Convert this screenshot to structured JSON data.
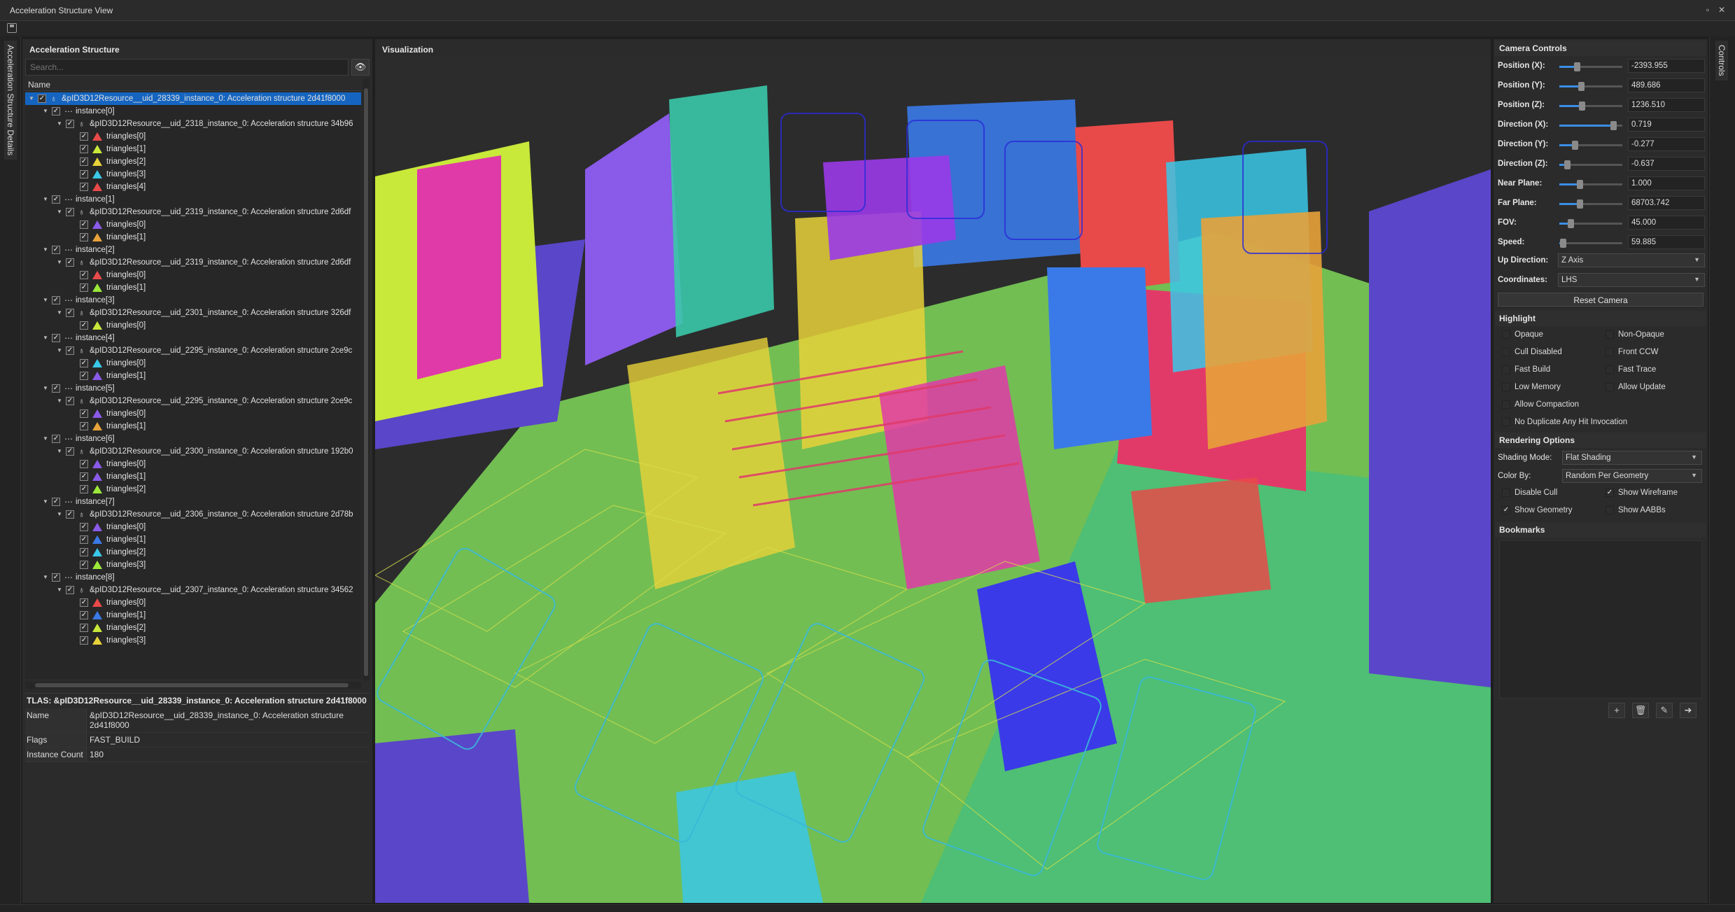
{
  "window": {
    "title": "Acceleration Structure View"
  },
  "left_tab": "Acceleration Structure Details",
  "right_tab": "Controls",
  "as_panel": {
    "title": "Acceleration Structure",
    "search_placeholder": "Search...",
    "column": "Name",
    "tree": [
      {
        "level": 0,
        "kind": "tlas",
        "label": "&pID3D12Resource__uid_28339_instance_0: Acceleration structure 2d41f8000",
        "selected": true
      },
      {
        "level": 1,
        "kind": "instance",
        "label": "instance[0]"
      },
      {
        "level": 2,
        "kind": "blas",
        "label": "&pID3D12Resource__uid_2318_instance_0: Acceleration structure 34b96"
      },
      {
        "level": 3,
        "kind": "tri",
        "color": "#e84a4a",
        "label": "triangles[0]"
      },
      {
        "level": 3,
        "kind": "tri",
        "color": "#c8e83a",
        "label": "triangles[1]"
      },
      {
        "level": 3,
        "kind": "tri",
        "color": "#e8d23a",
        "label": "triangles[2]"
      },
      {
        "level": 3,
        "kind": "tri",
        "color": "#3ac8e8",
        "label": "triangles[3]"
      },
      {
        "level": 3,
        "kind": "tri",
        "color": "#e84a4a",
        "label": "triangles[4]"
      },
      {
        "level": 1,
        "kind": "instance",
        "label": "instance[1]"
      },
      {
        "level": 2,
        "kind": "blas",
        "label": "&pID3D12Resource__uid_2319_instance_0: Acceleration structure 2d6df"
      },
      {
        "level": 3,
        "kind": "tri",
        "color": "#8a5ae8",
        "label": "triangles[0]"
      },
      {
        "level": 3,
        "kind": "tri",
        "color": "#e8a23a",
        "label": "triangles[1]"
      },
      {
        "level": 1,
        "kind": "instance",
        "label": "instance[2]"
      },
      {
        "level": 2,
        "kind": "blas",
        "label": "&pID3D12Resource__uid_2319_instance_0: Acceleration structure 2d6df"
      },
      {
        "level": 3,
        "kind": "tri",
        "color": "#e84a4a",
        "label": "triangles[0]"
      },
      {
        "level": 3,
        "kind": "tri",
        "color": "#9ae83a",
        "label": "triangles[1]"
      },
      {
        "level": 1,
        "kind": "instance",
        "label": "instance[3]"
      },
      {
        "level": 2,
        "kind": "blas",
        "label": "&pID3D12Resource__uid_2301_instance_0: Acceleration structure 326df"
      },
      {
        "level": 3,
        "kind": "tri",
        "color": "#c8e83a",
        "label": "triangles[0]"
      },
      {
        "level": 1,
        "kind": "instance",
        "label": "instance[4]"
      },
      {
        "level": 2,
        "kind": "blas",
        "label": "&pID3D12Resource__uid_2295_instance_0: Acceleration structure 2ce9c"
      },
      {
        "level": 3,
        "kind": "tri",
        "color": "#3ac8e8",
        "label": "triangles[0]"
      },
      {
        "level": 3,
        "kind": "tri",
        "color": "#8a5ae8",
        "label": "triangles[1]"
      },
      {
        "level": 1,
        "kind": "instance",
        "label": "instance[5]"
      },
      {
        "level": 2,
        "kind": "blas",
        "label": "&pID3D12Resource__uid_2295_instance_0: Acceleration structure 2ce9c"
      },
      {
        "level": 3,
        "kind": "tri",
        "color": "#8a5ae8",
        "label": "triangles[0]"
      },
      {
        "level": 3,
        "kind": "tri",
        "color": "#e8a23a",
        "label": "triangles[1]"
      },
      {
        "level": 1,
        "kind": "instance",
        "label": "instance[6]"
      },
      {
        "level": 2,
        "kind": "blas",
        "label": "&pID3D12Resource__uid_2300_instance_0: Acceleration structure 192b0"
      },
      {
        "level": 3,
        "kind": "tri",
        "color": "#8a5ae8",
        "label": "triangles[0]"
      },
      {
        "level": 3,
        "kind": "tri",
        "color": "#8a5ae8",
        "label": "triangles[1]"
      },
      {
        "level": 3,
        "kind": "tri",
        "color": "#9ae83a",
        "label": "triangles[2]"
      },
      {
        "level": 1,
        "kind": "instance",
        "label": "instance[7]"
      },
      {
        "level": 2,
        "kind": "blas",
        "label": "&pID3D12Resource__uid_2306_instance_0: Acceleration structure 2d78b"
      },
      {
        "level": 3,
        "kind": "tri",
        "color": "#8a5ae8",
        "label": "triangles[0]"
      },
      {
        "level": 3,
        "kind": "tri",
        "color": "#3a7ae8",
        "label": "triangles[1]"
      },
      {
        "level": 3,
        "kind": "tri",
        "color": "#3ac8e8",
        "label": "triangles[2]"
      },
      {
        "level": 3,
        "kind": "tri",
        "color": "#9ae83a",
        "label": "triangles[3]"
      },
      {
        "level": 1,
        "kind": "instance",
        "label": "instance[8]"
      },
      {
        "level": 2,
        "kind": "blas",
        "label": "&pID3D12Resource__uid_2307_instance_0: Acceleration structure 34562"
      },
      {
        "level": 3,
        "kind": "tri",
        "color": "#e84a4a",
        "label": "triangles[0]"
      },
      {
        "level": 3,
        "kind": "tri",
        "color": "#3a7ae8",
        "label": "triangles[1]"
      },
      {
        "level": 3,
        "kind": "tri",
        "color": "#c8e83a",
        "label": "triangles[2]"
      },
      {
        "level": 3,
        "kind": "tri",
        "color": "#e8d23a",
        "label": "triangles[3]"
      }
    ],
    "details_title": "TLAS: &pID3D12Resource__uid_28339_instance_0: Acceleration structure 2d41f8000",
    "details": [
      {
        "key": "Name",
        "value": "&pID3D12Resource__uid_28339_instance_0: Acceleration structure 2d41f8000"
      },
      {
        "key": "Flags",
        "value": "FAST_BUILD"
      },
      {
        "key": "Instance Count",
        "value": "180"
      }
    ]
  },
  "viz": {
    "title": "Visualization"
  },
  "controls": {
    "camera_title": "Camera Controls",
    "camera": [
      {
        "label": "Position (X):",
        "value": "-2393.955",
        "slider": 0.28
      },
      {
        "label": "Position (Y):",
        "value": "489.686",
        "slider": 0.34
      },
      {
        "label": "Position (Z):",
        "value": "1236.510",
        "slider": 0.36
      },
      {
        "label": "Direction (X):",
        "value": "0.719",
        "slider": 0.86
      },
      {
        "label": "Direction (Y):",
        "value": "-0.277",
        "slider": 0.24
      },
      {
        "label": "Direction (Z):",
        "value": "-0.637",
        "slider": 0.12
      },
      {
        "label": "Near Plane:",
        "value": "1.000",
        "slider": 0.32
      },
      {
        "label": "Far Plane:",
        "value": "68703.742",
        "slider": 0.32
      },
      {
        "label": "FOV:",
        "value": "45.000",
        "slider": 0.18
      },
      {
        "label": "Speed:",
        "value": "59.885",
        "slider": 0.06
      }
    ],
    "up_direction_label": "Up Direction:",
    "up_direction_value": "Z Axis",
    "coordinates_label": "Coordinates:",
    "coordinates_value": "LHS",
    "reset_label": "Reset Camera",
    "highlight_title": "Highlight",
    "highlight": [
      {
        "label": "Opaque",
        "checked": false
      },
      {
        "label": "Non-Opaque",
        "checked": false
      },
      {
        "label": "Cull Disabled",
        "checked": false
      },
      {
        "label": "Front CCW",
        "checked": false
      },
      {
        "label": "Fast Build",
        "checked": false
      },
      {
        "label": "Fast Trace",
        "checked": false
      },
      {
        "label": "Low Memory",
        "checked": false
      },
      {
        "label": "Allow Update",
        "checked": false
      },
      {
        "label": "Allow Compaction",
        "checked": false
      },
      {
        "label": "No Duplicate Any Hit Invocation",
        "checked": false
      }
    ],
    "rendering_title": "Rendering Options",
    "shading_label": "Shading Mode:",
    "shading_value": "Flat Shading",
    "colorby_label": "Color By:",
    "colorby_value": "Random Per Geometry",
    "render_checks": [
      {
        "label": "Disable Cull",
        "checked": false
      },
      {
        "label": "Show Wireframe",
        "checked": true
      },
      {
        "label": "Show Geometry",
        "checked": true
      },
      {
        "label": "Show AABBs",
        "checked": false
      }
    ],
    "bookmarks_title": "Bookmarks",
    "bookmark_buttons": [
      "add-icon",
      "delete-icon",
      "edit-icon",
      "goto-icon"
    ]
  }
}
